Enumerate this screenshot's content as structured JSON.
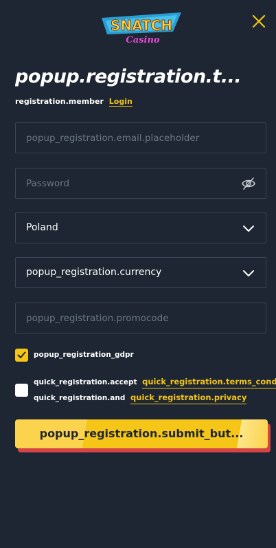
{
  "logo": {
    "line1": "SNATCH",
    "line2": "Casino"
  },
  "header": {
    "title": "popup.registration.t..."
  },
  "member": {
    "text": "registration.member",
    "login": "Login"
  },
  "form": {
    "email_placeholder": "popup_registration.email.placeholder",
    "password_placeholder": "Password",
    "country_value": "Poland",
    "currency_value": "popup_registration.currency",
    "promocode_placeholder": "popup_registration.promocode"
  },
  "gdpr": {
    "label": "popup_registration_gdpr",
    "checked": true
  },
  "terms": {
    "accept": "quick_registration.accept",
    "terms_link": "quick_registration.terms_cond",
    "and": "quick_registration.and",
    "privacy_link": "quick_registration.privacy",
    "checked": false
  },
  "submit": {
    "label": "popup_registration.submit_but..."
  },
  "colors": {
    "background": "#1d2632",
    "accent": "#f5c518",
    "border": "#3a4656",
    "button_shadow": "#d64545"
  }
}
